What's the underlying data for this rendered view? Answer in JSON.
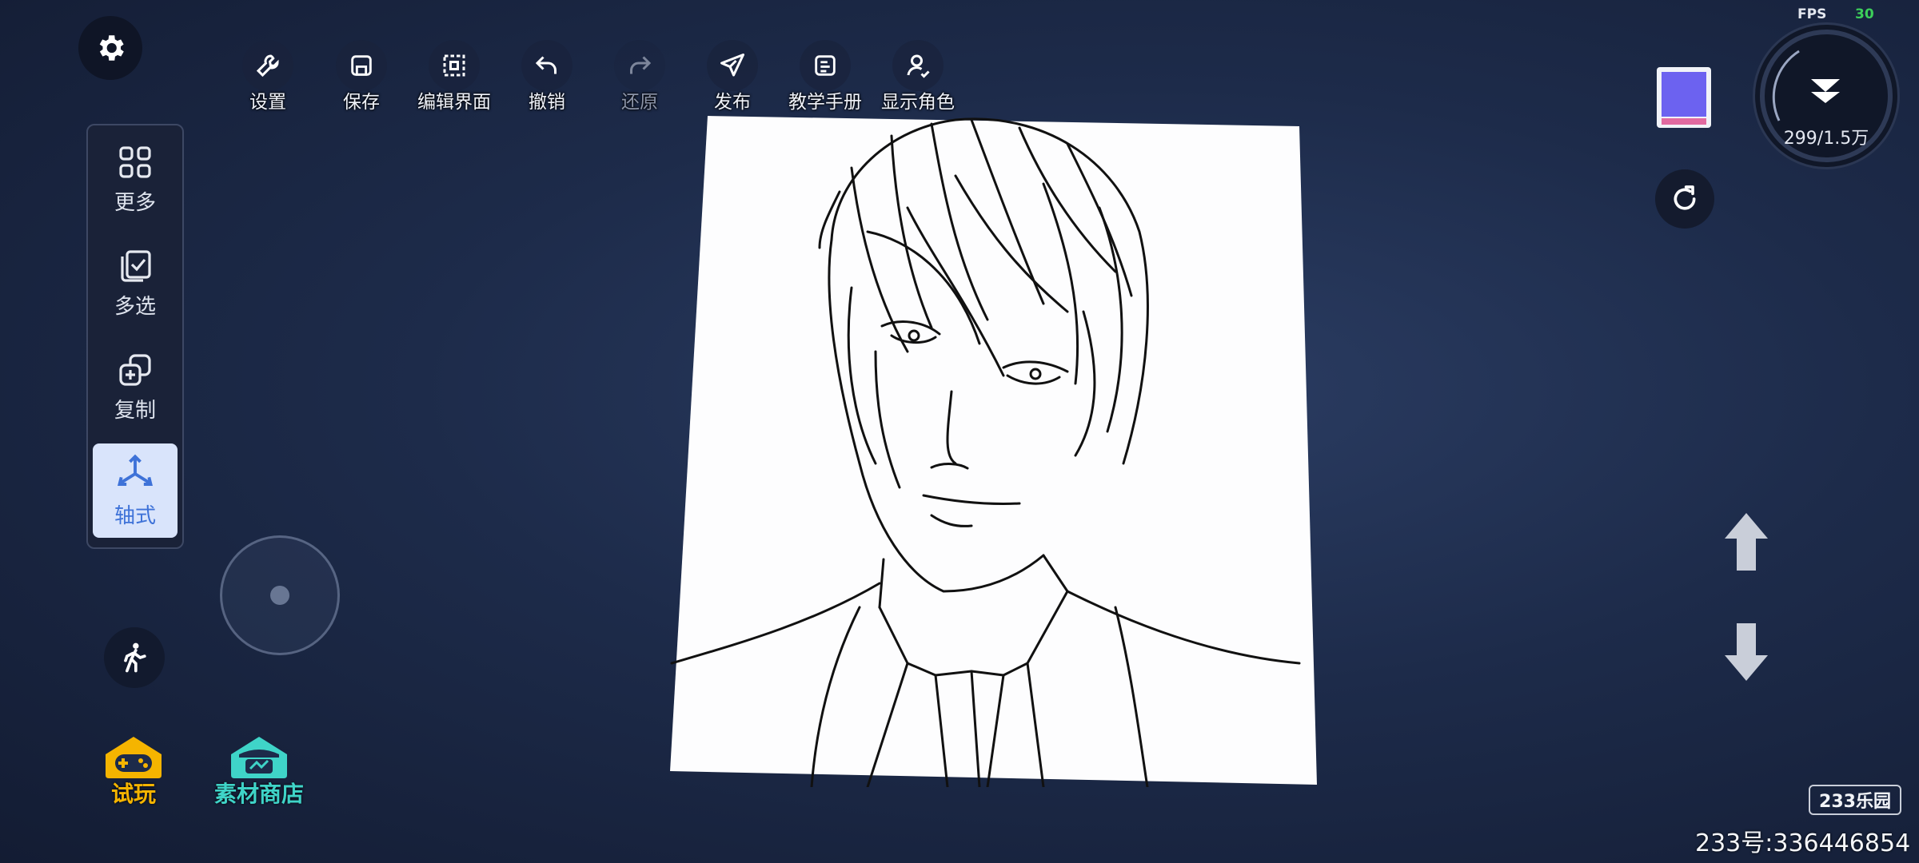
{
  "toolbar": {
    "items": [
      {
        "label": "设置",
        "icon": "wrench-icon"
      },
      {
        "label": "保存",
        "icon": "save-icon"
      },
      {
        "label": "编辑界面",
        "icon": "edit-frame-icon"
      },
      {
        "label": "撤销",
        "icon": "undo-icon"
      },
      {
        "label": "还原",
        "icon": "redo-icon",
        "disabled": true
      },
      {
        "label": "发布",
        "icon": "publish-icon"
      },
      {
        "label": "教学手册",
        "icon": "manual-icon"
      },
      {
        "label": "显示角色",
        "icon": "character-icon"
      }
    ]
  },
  "side_panel": {
    "items": [
      {
        "label": "更多",
        "icon": "grid-icon"
      },
      {
        "label": "多选",
        "icon": "multi-select-icon"
      },
      {
        "label": "复制",
        "icon": "copy-icon"
      },
      {
        "label": "轴式",
        "icon": "axis-icon",
        "active": true
      }
    ]
  },
  "bottom": {
    "trial_label": "试玩",
    "shop_label": "素材商店"
  },
  "status": {
    "fps_label": "FPS",
    "fps_value": "30",
    "counter": "299/1.5万"
  },
  "branding": {
    "badge": "233乐园",
    "watermark": "233号:336446854"
  },
  "colors": {
    "selected_color": "#6c62f0",
    "active_accent": "#3e72d8",
    "trial_color": "#f5b400",
    "shop_color": "#3fd4c8"
  }
}
